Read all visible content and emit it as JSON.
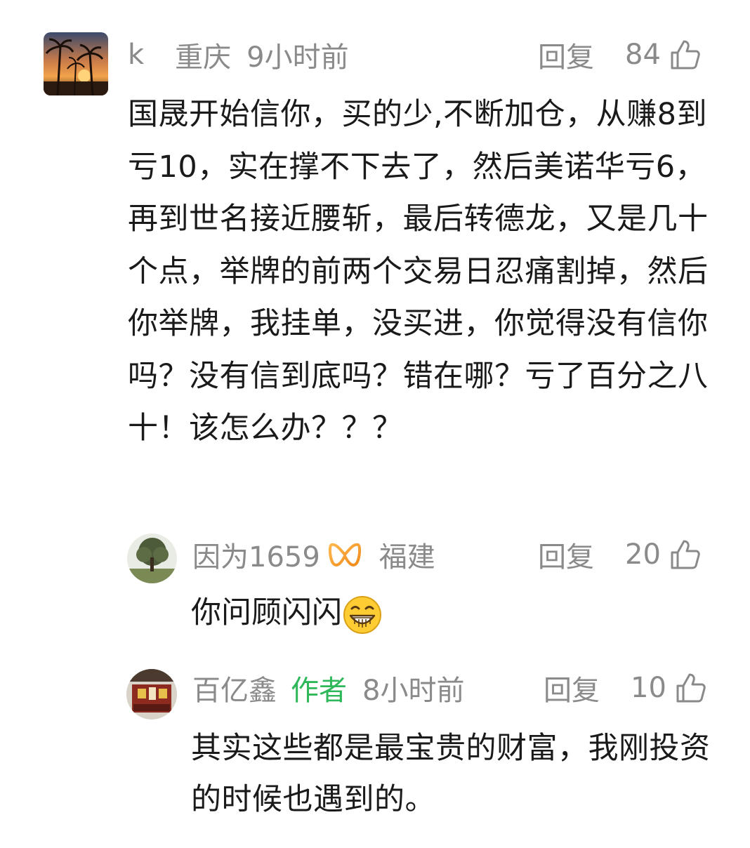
{
  "comments": [
    {
      "user": "k",
      "location": "重庆",
      "time": "9小时前",
      "reply_label": "回复",
      "likes": "84",
      "text": "国晟开始信你，买的少,不断加仓，从赚8到亏10，实在撑不下去了，然后美诺华亏6，再到世名接近腰斩，最后转德龙，又是几十个点，举牌的前两个交易日忍痛割掉，然后你举牌，我挂单，没买进，你觉得没有信你吗？没有信到底吗？错在哪？亏了百分之八十！该怎么办？？？"
    },
    {
      "user": "因为1659",
      "location": "福建",
      "reply_label": "回复",
      "likes": "20",
      "text": "你问顾闪闪"
    },
    {
      "user": "百亿鑫",
      "author_badge": "作者",
      "time": "8小时前",
      "reply_label": "回复",
      "likes": "10",
      "text": "其实这些都是最宝贵的财富，我刚投资的时候也遇到的。"
    }
  ],
  "colors": {
    "author": "#2fb85a",
    "meta": "#8a8a8a",
    "text": "#1a1a1a"
  }
}
